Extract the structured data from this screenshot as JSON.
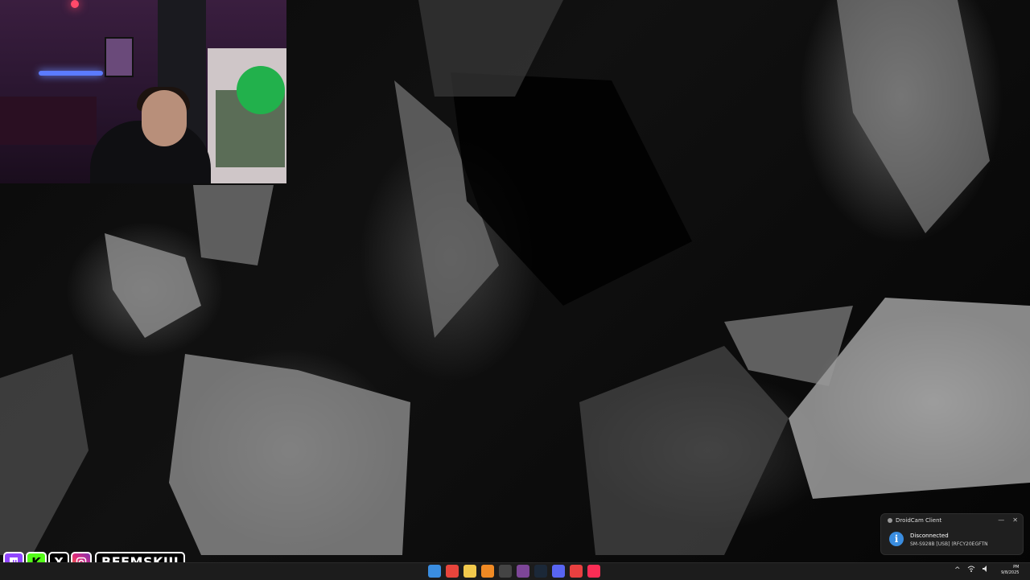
{
  "social": {
    "handle": "BEEMSKIII",
    "icons": [
      "twitch-icon",
      "kick-icon",
      "x-icon",
      "instagram-icon"
    ]
  },
  "notification": {
    "app_name": "DroidCam Client",
    "title": "Disconnected",
    "detail": "SM-S928B [USB] (RFCY20EGFTN",
    "minimize_glyph": "—",
    "close_glyph": "✕",
    "info_glyph": "i"
  },
  "taskbar": {
    "apps": [
      {
        "name": "start-icon",
        "color": "#3a8de0"
      },
      {
        "name": "chrome-icon",
        "color": "#e8453c"
      },
      {
        "name": "file-explorer-icon",
        "color": "#f2c94c"
      },
      {
        "name": "browser-icon",
        "color": "#f08a24"
      },
      {
        "name": "obs-icon",
        "color": "#444444"
      },
      {
        "name": "tor-browser-icon",
        "color": "#7d4698"
      },
      {
        "name": "steam-icon",
        "color": "#1b2838"
      },
      {
        "name": "discord-icon",
        "color": "#5865f2"
      },
      {
        "name": "recorder-icon",
        "color": "#e84040"
      },
      {
        "name": "music-icon",
        "color": "#fa2d55"
      }
    ],
    "tray_chevron": "^",
    "clock_time": "PM",
    "clock_date": "9/8/2025"
  }
}
